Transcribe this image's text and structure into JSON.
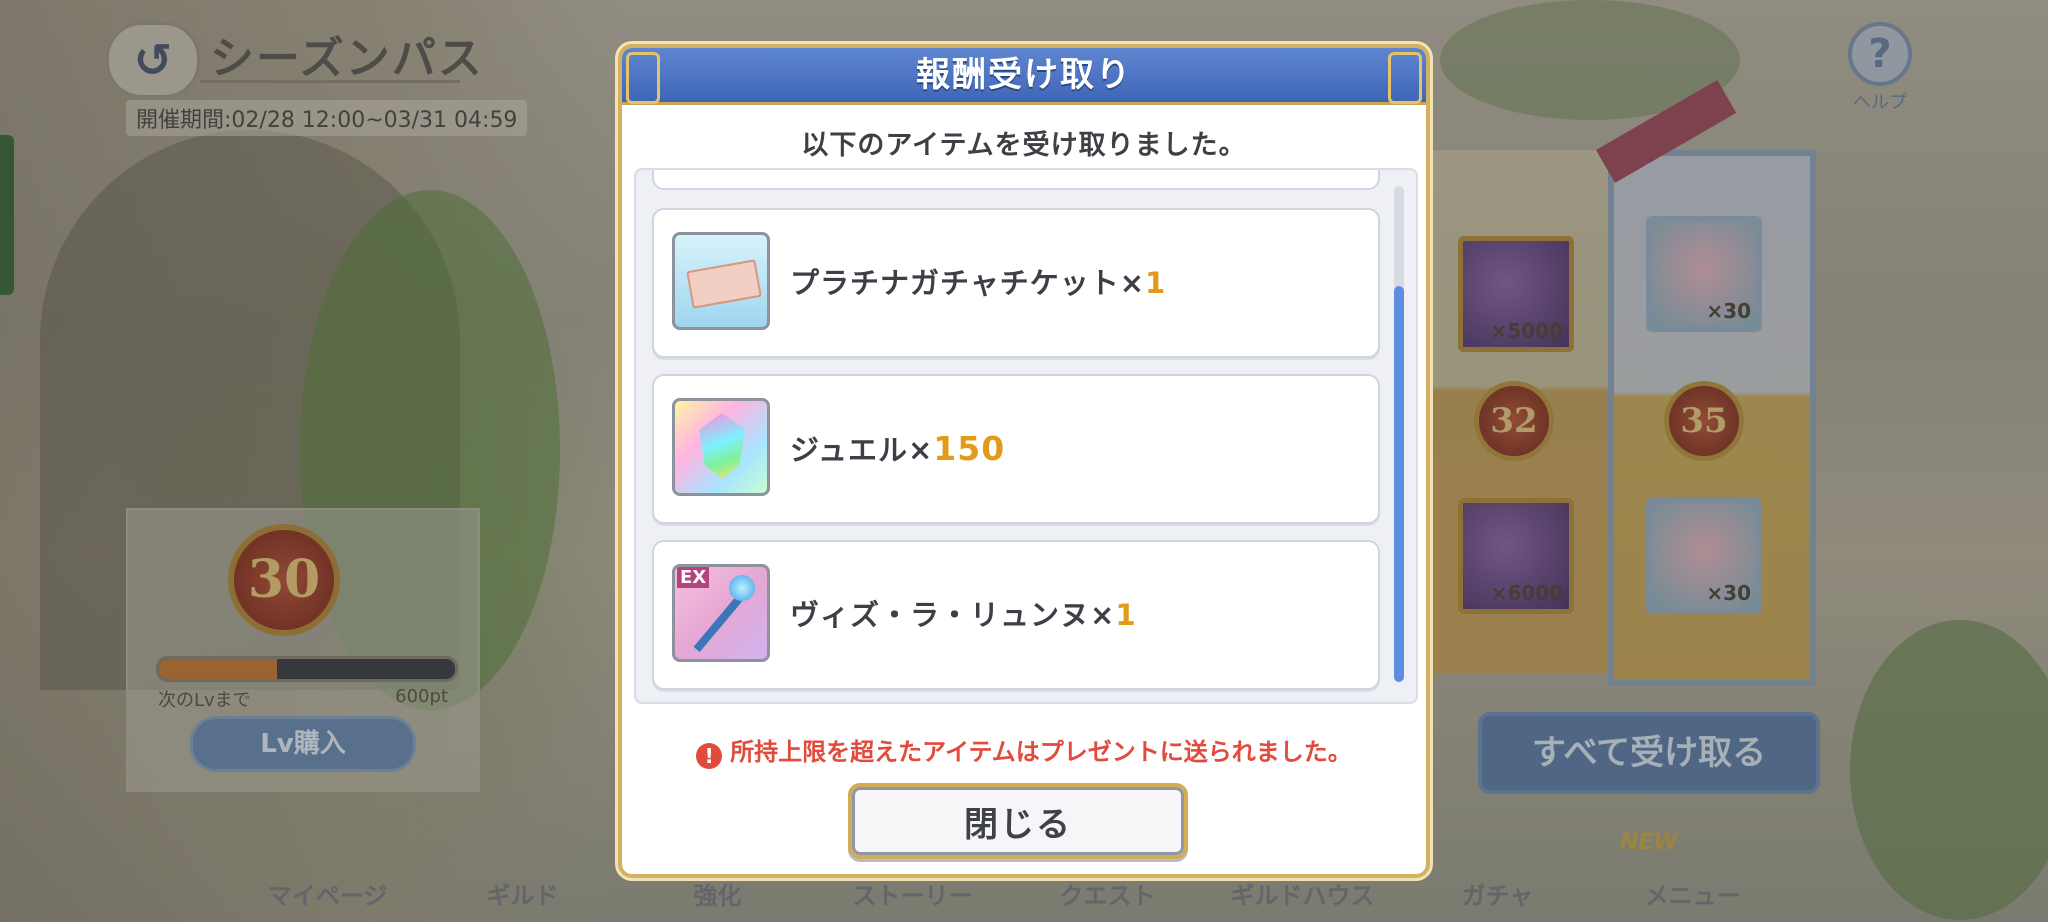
{
  "header": {
    "back_icon_glyph": "↺",
    "title": "シーズンパス",
    "period": "開催期間:02/28 12:00~03/31 04:59",
    "help_label": "ヘルプ",
    "help_glyph": "?"
  },
  "level": {
    "value": "30",
    "progress_fraction": 0.4,
    "next_label": "次のLvまで",
    "next_points": "600pt",
    "buy_button": "Lv購入"
  },
  "rewards_bg": {
    "tiles": [
      {
        "count": "×5000"
      },
      {
        "count": "×30"
      },
      {
        "count": "×6000"
      },
      {
        "count": "×30"
      }
    ],
    "medals": [
      "32",
      "35"
    ],
    "claim_all": "すべて受け取る"
  },
  "bottom_nav": {
    "items": [
      "マイページ",
      "ギルド",
      "強化",
      "ストーリー",
      "クエスト",
      "ギルドハウス",
      "ガチャ",
      "メニュー"
    ],
    "new_badge": "NEW"
  },
  "modal": {
    "title": "報酬受け取り",
    "subtitle": "以下のアイテムを受け取りました。",
    "items": [
      {
        "name": "プラチナガチャチケット×",
        "qty": "1",
        "icon": "platinum-gacha-ticket-icon"
      },
      {
        "name": "ジュエル×",
        "qty": "150",
        "icon": "jewel-icon"
      },
      {
        "name": "ヴィズ・ラ・リュンヌ×",
        "qty": "1",
        "icon": "ex-equipment-icon",
        "badge": "EX"
      }
    ],
    "notice_glyph": "!",
    "notice": "所持上限を超えたアイテムはプレゼントに送られました。",
    "close_button": "閉じる"
  },
  "colors": {
    "modal_header": "#3f65b8",
    "qty_accent": "#e29b18",
    "notice": "#e24a3c",
    "gold_border": "#d4b062"
  }
}
